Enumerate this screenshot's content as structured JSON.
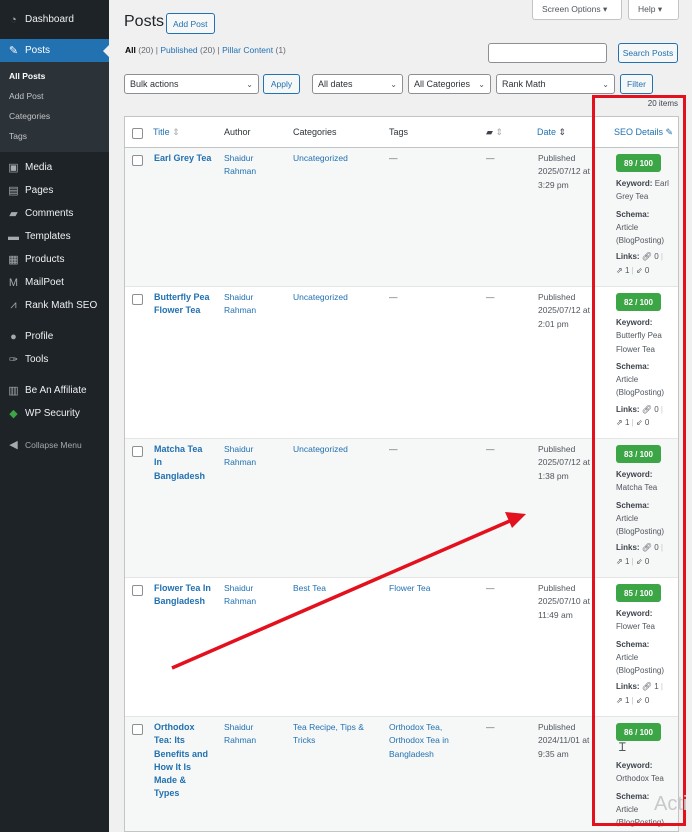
{
  "sidebar": {
    "items": [
      {
        "label": "Dashboard",
        "icon": "dashboard-icon"
      },
      {
        "label": "Posts",
        "icon": "pushpin-icon",
        "current": true
      },
      {
        "label": "Media",
        "icon": "media-icon"
      },
      {
        "label": "Pages",
        "icon": "pages-icon"
      },
      {
        "label": "Comments",
        "icon": "comments-icon"
      },
      {
        "label": "Templates",
        "icon": "folder-icon"
      },
      {
        "label": "Products",
        "icon": "archive-icon"
      },
      {
        "label": "MailPoet",
        "icon": "mailpoet-icon"
      },
      {
        "label": "Rank Math SEO",
        "icon": "chart-icon"
      },
      {
        "label": "Profile",
        "icon": "user-icon"
      },
      {
        "label": "Tools",
        "icon": "wrench-icon"
      },
      {
        "label": "Be An Affiliate",
        "icon": "money-icon"
      },
      {
        "label": "WP Security",
        "icon": "shield-icon"
      },
      {
        "label": "Collapse Menu",
        "icon": "collapse-icon"
      }
    ],
    "submenu": [
      "All Posts",
      "Add Post",
      "Categories",
      "Tags"
    ]
  },
  "header": {
    "screen_options": "Screen Options ▾",
    "help": "Help ▾",
    "title": "Posts",
    "add_post": "Add Post"
  },
  "views": {
    "all": "All",
    "all_count": "(20)",
    "published": "Published",
    "published_count": "(20)",
    "pillar": "Pillar Content",
    "pillar_count": "(1)"
  },
  "search": {
    "button": "Search Posts",
    "placeholder": ""
  },
  "filters": {
    "bulk": "Bulk actions",
    "apply": "Apply",
    "dates": "All dates",
    "categories": "All Categories",
    "rank_math": "Rank Math",
    "filter": "Filter",
    "items": "20 items"
  },
  "columns": {
    "title": "Title",
    "author": "Author",
    "categories": "Categories",
    "tags": "Tags",
    "date": "Date",
    "seo": "SEO Details"
  },
  "posts": [
    {
      "title": [
        "Earl Grey Tea"
      ],
      "author": [
        "Shaidur",
        "Rahman"
      ],
      "categories": [
        "Uncategorized"
      ],
      "tags": [
        "—"
      ],
      "comments": "—",
      "date": [
        "Published",
        "2025/07/12 at",
        "3:29 pm"
      ],
      "score": "89 / 100",
      "keyword": [
        "Earl",
        "Grey Tea"
      ],
      "schema": [
        "Article",
        "(BlogPosting)"
      ],
      "links_internal": "0",
      "links_external": "1",
      "links_incoming": "0"
    },
    {
      "title": [
        "Butterfly Pea",
        "Flower Tea"
      ],
      "author": [
        "Shaidur",
        "Rahman"
      ],
      "categories": [
        "Uncategorized"
      ],
      "tags": [
        "—"
      ],
      "comments": "—",
      "date": [
        "Published",
        "2025/07/12 at",
        "2:01 pm"
      ],
      "score": "82 / 100",
      "keyword": [
        "",
        "Butterfly Pea",
        "Flower Tea"
      ],
      "schema": [
        "Article",
        "(BlogPosting)"
      ],
      "links_internal": "0",
      "links_external": "1",
      "links_incoming": "0"
    },
    {
      "title": [
        "Matcha Tea",
        "In",
        "Bangladesh"
      ],
      "author": [
        "Shaidur",
        "Rahman"
      ],
      "categories": [
        "Uncategorized"
      ],
      "tags": [
        "—"
      ],
      "comments": "—",
      "date": [
        "Published",
        "2025/07/12 at",
        "1:38 pm"
      ],
      "score": "83 / 100",
      "keyword": [
        "",
        "Matcha Tea"
      ],
      "schema": [
        "Article",
        "(BlogPosting)"
      ],
      "links_internal": "0",
      "links_external": "1",
      "links_incoming": "0"
    },
    {
      "title": [
        "Flower Tea In",
        "Bangladesh"
      ],
      "author": [
        "Shaidur",
        "Rahman"
      ],
      "categories": [
        "Best Tea"
      ],
      "tags": [
        "Flower Tea"
      ],
      "comments": "—",
      "date": [
        "Published",
        "2025/07/10 at",
        "11:49 am"
      ],
      "score": "85 / 100",
      "keyword": [
        "",
        "Flower Tea"
      ],
      "schema": [
        "Article",
        "(BlogPosting)"
      ],
      "links_internal": "1",
      "links_external": "1",
      "links_incoming": "0"
    },
    {
      "title": [
        "Orthodox",
        "Tea: Its",
        "Benefits and",
        "How It Is",
        "Made &",
        "Types"
      ],
      "author": [
        "Shaidur",
        "Rahman"
      ],
      "categories": [
        "Tea Recipe, Tips &",
        "Tricks"
      ],
      "tags": [
        "Orthodox Tea,",
        "Orthodox Tea in",
        "Bangladesh"
      ],
      "comments": "—",
      "date": [
        "Published",
        "2024/11/01 at",
        "9:35 am"
      ],
      "score": "86 / 100",
      "keyword": [
        "",
        "Orthodox Tea"
      ],
      "schema": [
        "Article",
        "(BlogPosting)"
      ]
    }
  ],
  "seo_labels": {
    "keyword": "Keyword:",
    "schema": "Schema:",
    "links": "Links:"
  },
  "watermark": "Acti",
  "colors": {
    "sidebar": "#1d2327",
    "accent": "#2271b1",
    "score_green": "#3ca545",
    "annotation_red": "#e3101d"
  }
}
